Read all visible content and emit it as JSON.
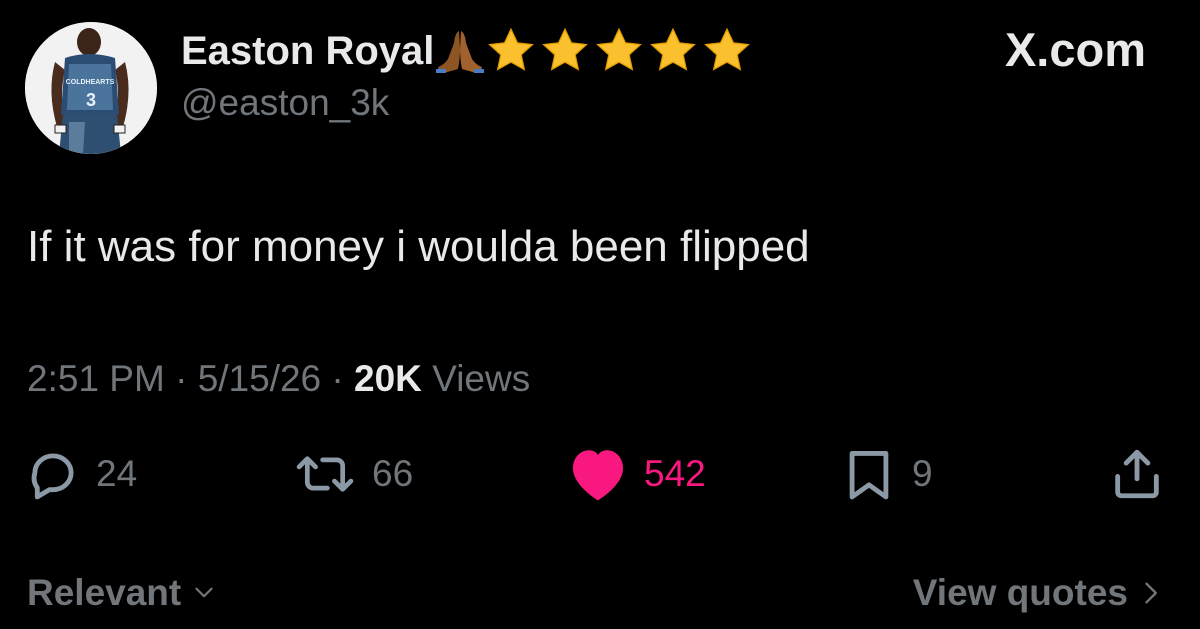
{
  "author": {
    "display_name": "Easton Royal",
    "name_emojis": [
      "folded-hands-icon",
      "star-icon",
      "star-icon",
      "star-icon",
      "star-icon",
      "star-icon"
    ],
    "handle": "@easton_3k",
    "avatar_jersey_text": "COLDHEARTS"
  },
  "watermark": "X.com",
  "tweet": {
    "text": "If it was for money i woulda been flipped",
    "time": "2:51 PM",
    "date": "5/15/26",
    "separator": "·",
    "views_count": "20K",
    "views_label": "Views"
  },
  "actions": {
    "replies": "24",
    "reposts": "66",
    "likes": "542",
    "bookmarks": "9",
    "liked": true,
    "like_color": "#f91880"
  },
  "footer": {
    "sort_label": "Relevant",
    "quotes_label": "View quotes"
  },
  "colors": {
    "background": "#000000",
    "primary_text": "#e7e9ea",
    "secondary_text": "#71767b",
    "star": "#f5c518"
  }
}
